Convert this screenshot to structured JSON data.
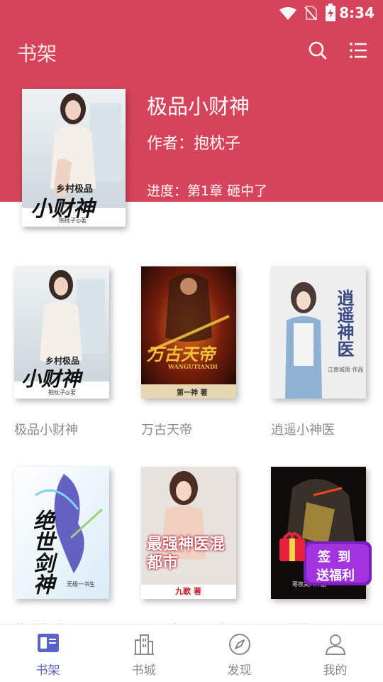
{
  "status_bar": {
    "time": "8:34"
  },
  "header": {
    "title": "书架"
  },
  "featured": {
    "title": "极品小财神",
    "author": "作者：抱枕子",
    "progress": "进度：第1章 砸中了",
    "cover": {
      "title_small": "乡村极品",
      "title_big": "小财神",
      "byline": "抱枕子◎著",
      "palette": [
        "#e8eef2",
        "#b9c6cf"
      ]
    }
  },
  "books": [
    {
      "title": "极品小财神",
      "cover": {
        "title_small": "乡村极品",
        "title_big": "小财神",
        "byline": "抱枕子◎著"
      }
    },
    {
      "title": "万古天帝",
      "cover": {
        "title_big": "万古天帝",
        "subtitle": "WANGUTIANDI",
        "byline": "第一神 著"
      }
    },
    {
      "title": "逍遥小神医",
      "cover": {
        "title_big": "逍遥神医",
        "byline": "江南城雨 作品"
      }
    },
    {
      "title": "绝世剑神",
      "cover": {
        "title_big": "绝世剑神",
        "byline": "无极一书生"
      }
    },
    {
      "title": "最强神医混都市",
      "cover": {
        "title_big": "最强神医混都市",
        "byline": "九歌 著"
      }
    },
    {
      "title": "至尊战王",
      "cover": {
        "byline": "寒夜美人作品"
      }
    }
  ],
  "checkin": {
    "line1": "签 到",
    "line2": "送福利"
  },
  "nav": [
    {
      "label": "书架",
      "icon": "bookshelf-icon",
      "active": true
    },
    {
      "label": "书城",
      "icon": "bookstore-icon",
      "active": false
    },
    {
      "label": "发现",
      "icon": "compass-icon",
      "active": false
    },
    {
      "label": "我的",
      "icon": "person-icon",
      "active": false
    }
  ],
  "colors": {
    "brand": "#d5445a",
    "nav_active": "#5b62c9",
    "nav_inactive": "#8a8a8a"
  }
}
